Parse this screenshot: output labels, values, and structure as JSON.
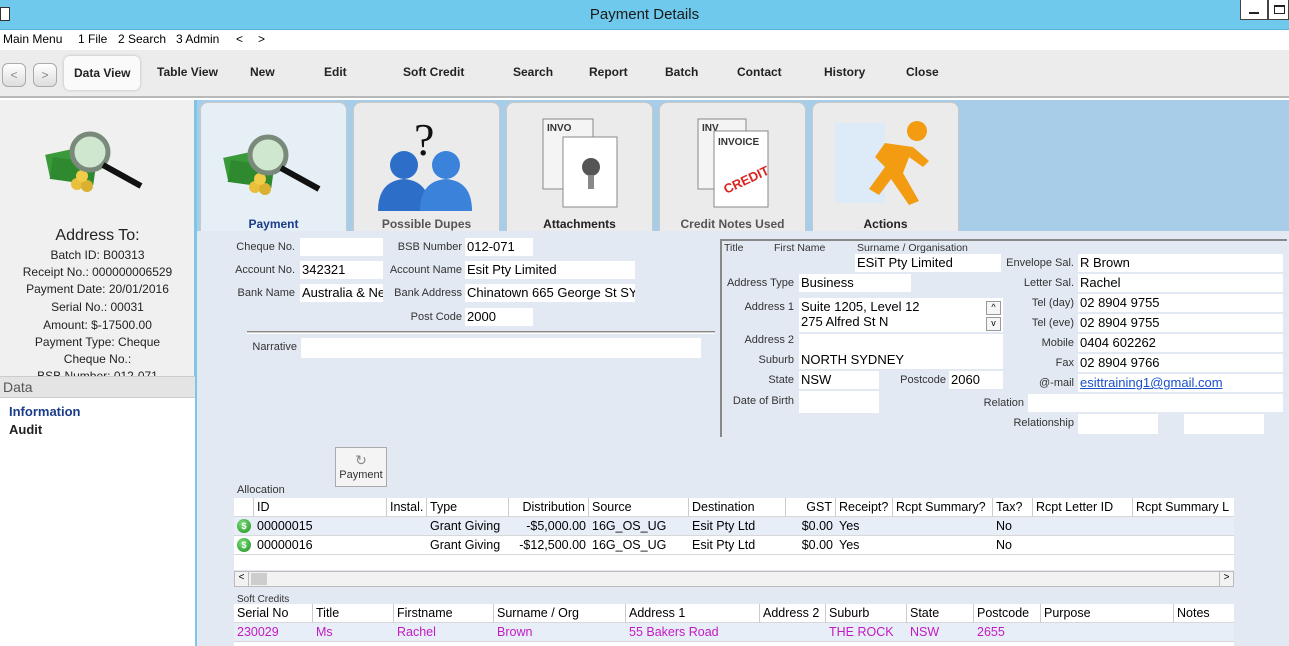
{
  "window": {
    "title": "Payment Details"
  },
  "menu": [
    "Main Menu",
    "1 File",
    "2 Search",
    "3 Admin",
    "<",
    ">"
  ],
  "toolbar": {
    "back": "<",
    "forward": ">",
    "items": [
      "Data View",
      "Table View",
      "New",
      "Edit",
      "Soft Credit",
      "Search",
      "Report",
      "Batch",
      "Contact",
      "History",
      "Close"
    ]
  },
  "left": {
    "address_to": "Address To:",
    "lines": [
      "Batch ID: B00313",
      "Receipt No.: 000000006529",
      "Payment Date: 20/01/2016",
      "Serial No.: 00031",
      "Amount: $-17500.00",
      "Payment Type: Cheque",
      "Cheque No.:",
      "BSB Number: 012-071"
    ],
    "data_header": "Data",
    "data_items": [
      "Information",
      "Audit"
    ]
  },
  "tabs": [
    "Payment",
    "Possible Dupes",
    "Attachments",
    "Credit Notes Used",
    "Actions"
  ],
  "icons": {
    "payment": "money-magnifier-icon",
    "dupes": "question-people-icon",
    "attach": "document-pin-icon",
    "credit": "invoice-credit-icon",
    "actions": "running-man-icon"
  },
  "payment": {
    "cheque_no_label": "Cheque No.",
    "cheque_no": "",
    "account_no_label": "Account No.",
    "account_no": "342321",
    "bank_name_label": "Bank Name",
    "bank_name": "Australia & Ne",
    "bsb_label": "BSB Number",
    "bsb": "012-071",
    "account_name_label": "Account Name",
    "account_name": "Esit Pty Limited",
    "bank_address_label": "Bank Address",
    "bank_address": "Chinatown 665 George St SY",
    "post_code_label": "Post Code",
    "post_code": "2000",
    "narrative_label": "Narrative",
    "narrative": ""
  },
  "contact": {
    "title_label": "Title",
    "first_name_label": "First Name",
    "surname_label": "Surname / Organisation",
    "surname": "ESiT Pty Limited",
    "address_type_label": "Address Type",
    "address_type": "Business",
    "address1_label": "Address 1",
    "address1_line1": "Suite 1205, Level 12",
    "address1_line2": "275 Alfred St N",
    "address2_label": "Address 2",
    "suburb_label": "Suburb",
    "suburb": "NORTH SYDNEY",
    "state_label": "State",
    "state": "NSW",
    "postcode_label": "Postcode",
    "postcode": "2060",
    "dob_label": "Date of Birth",
    "envelope_label": "Envelope Sal.",
    "envelope": "R Brown",
    "letter_label": "Letter Sal.",
    "letter": "Rachel",
    "tel_day_label": "Tel (day)",
    "tel_day": "02 8904 9755",
    "tel_eve_label": "Tel (eve)",
    "tel_eve": "02 8904 9755",
    "mobile_label": "Mobile",
    "mobile": "0404 602262",
    "fax_label": "Fax",
    "fax": "02 8904 9766",
    "email_label": "@-mail",
    "email": "esittraining1@gmail.com",
    "relation_label": "Relation",
    "relationship_label": "Relationship"
  },
  "payment_button": "Payment",
  "allocation": {
    "label": "Allocation",
    "columns": [
      "ID",
      "Instal.",
      "Type",
      "Distribution",
      "Source",
      "Destination",
      "GST",
      "Receipt?",
      "Rcpt Summary?",
      "Tax?",
      "Rcpt Letter ID",
      "Rcpt Summary L"
    ],
    "rows": [
      [
        "00000015",
        "",
        "Grant Giving",
        "-$5,000.00",
        "16G_OS_UG",
        "Esit Pty Ltd",
        "$0.00",
        "Yes",
        "",
        "No",
        "",
        ""
      ],
      [
        "00000016",
        "",
        "Grant Giving",
        "-$12,500.00",
        "16G_OS_UG",
        "Esit Pty Ltd",
        "$0.00",
        "Yes",
        "",
        "No",
        "",
        ""
      ]
    ]
  },
  "soft_credits": {
    "label": "Soft Credits",
    "columns": [
      "Serial No",
      "Title",
      "Firstname",
      "Surname / Org",
      "Address 1",
      "Address 2",
      "Suburb",
      "State",
      "Postcode",
      "Purpose",
      "Notes"
    ],
    "rows": [
      [
        "230029",
        "Ms",
        "Rachel",
        "Brown",
        "55 Bakers Road",
        "",
        "THE ROCK",
        "NSW",
        "2655",
        "",
        ""
      ]
    ]
  },
  "scroll": {
    "left": "<",
    "right": ">",
    "up": "^",
    "down": "v"
  }
}
